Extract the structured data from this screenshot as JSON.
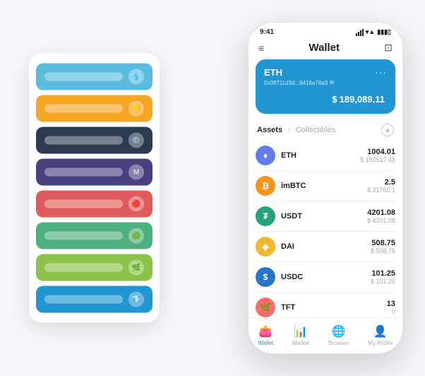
{
  "scene": {
    "background": "#f5f7fa"
  },
  "card_stack": {
    "cards": [
      {
        "color": "#5bbcdd",
        "bar_color": "rgba(255,255,255,0.5)",
        "icon": "💧"
      },
      {
        "color": "#f5a623",
        "bar_color": "rgba(255,255,255,0.5)",
        "icon": "🟡"
      },
      {
        "color": "#2d3a4f",
        "bar_color": "rgba(255,255,255,0.5)",
        "icon": "⚙️"
      },
      {
        "color": "#4a4080",
        "bar_color": "rgba(255,255,255,0.5)",
        "icon": "M"
      },
      {
        "color": "#e05c5c",
        "bar_color": "rgba(255,255,255,0.5)",
        "icon": "🔴"
      },
      {
        "color": "#4caf7d",
        "bar_color": "rgba(255,255,255,0.5)",
        "icon": "🟢"
      },
      {
        "color": "#8bc34a",
        "bar_color": "rgba(255,255,255,0.5)",
        "icon": "🌿"
      },
      {
        "color": "#2196d3",
        "bar_color": "rgba(255,255,255,0.5)",
        "icon": "💎"
      }
    ]
  },
  "phone": {
    "status_bar": {
      "time": "9:41",
      "signal": "●●●",
      "wifi": "WiFi",
      "battery": "🔋"
    },
    "header": {
      "menu_icon": "≡",
      "title": "Wallet",
      "expand_icon": "⊡"
    },
    "wallet_card": {
      "coin": "ETH",
      "dots": "···",
      "address": "0x08711d3d...8416a78a3",
      "address_icon": "⧉",
      "balance_symbol": "$",
      "balance": "189,089.11"
    },
    "assets": {
      "tab_active": "Assets",
      "divider": "/",
      "tab_inactive": "Collectibles",
      "add_icon": "+"
    },
    "asset_list": [
      {
        "symbol": "ETH",
        "icon_label": "♦",
        "icon_color": "#627EEA",
        "amount": "1004.01",
        "value": "$ 162517.48"
      },
      {
        "symbol": "imBTC",
        "icon_label": "₿",
        "icon_color": "#F7931A",
        "amount": "2.5",
        "value": "$ 21760.1"
      },
      {
        "symbol": "USDT",
        "icon_label": "₮",
        "icon_color": "#26A17B",
        "amount": "4201.08",
        "value": "$ 4201.08"
      },
      {
        "symbol": "DAI",
        "icon_label": "◈",
        "icon_color": "#F4B731",
        "amount": "508.75",
        "value": "$ 508.75"
      },
      {
        "symbol": "USDC",
        "icon_label": "$",
        "icon_color": "#2775CA",
        "amount": "101.25",
        "value": "$ 101.25"
      },
      {
        "symbol": "TFT",
        "icon_label": "🌿",
        "icon_color": "#FF6B6B",
        "amount": "13",
        "value": "0"
      }
    ],
    "nav": [
      {
        "icon": "👛",
        "label": "Wallet",
        "active": true
      },
      {
        "icon": "📊",
        "label": "Market",
        "active": false
      },
      {
        "icon": "🌐",
        "label": "Browser",
        "active": false
      },
      {
        "icon": "👤",
        "label": "My Profile",
        "active": false
      }
    ]
  }
}
